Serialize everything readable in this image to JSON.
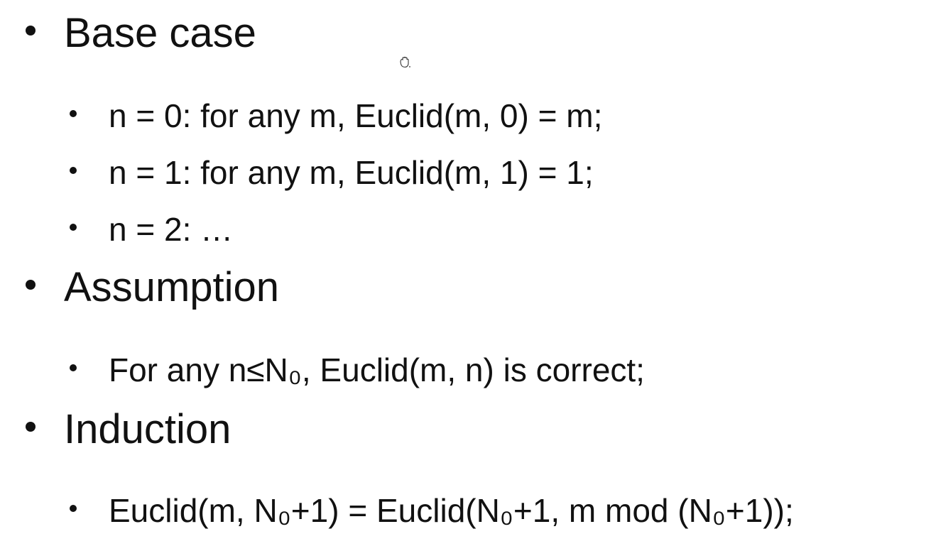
{
  "sections": [
    {
      "heading": "Base case",
      "items": [
        "n = 0: for any m, Euclid(m, 0) = m;",
        "n = 1: for any m, Euclid(m, 1) = 1;",
        "n = 2: …"
      ]
    },
    {
      "heading": "Assumption",
      "items": [
        "For any n≤N₀, Euclid(m, n) is correct;"
      ]
    },
    {
      "heading": "Induction",
      "items": [
        "Euclid(m, N₀+1) = Euclid(N₀+1, m mod (N₀+1));"
      ]
    }
  ],
  "cursor_icon": "hand-grab-icon"
}
